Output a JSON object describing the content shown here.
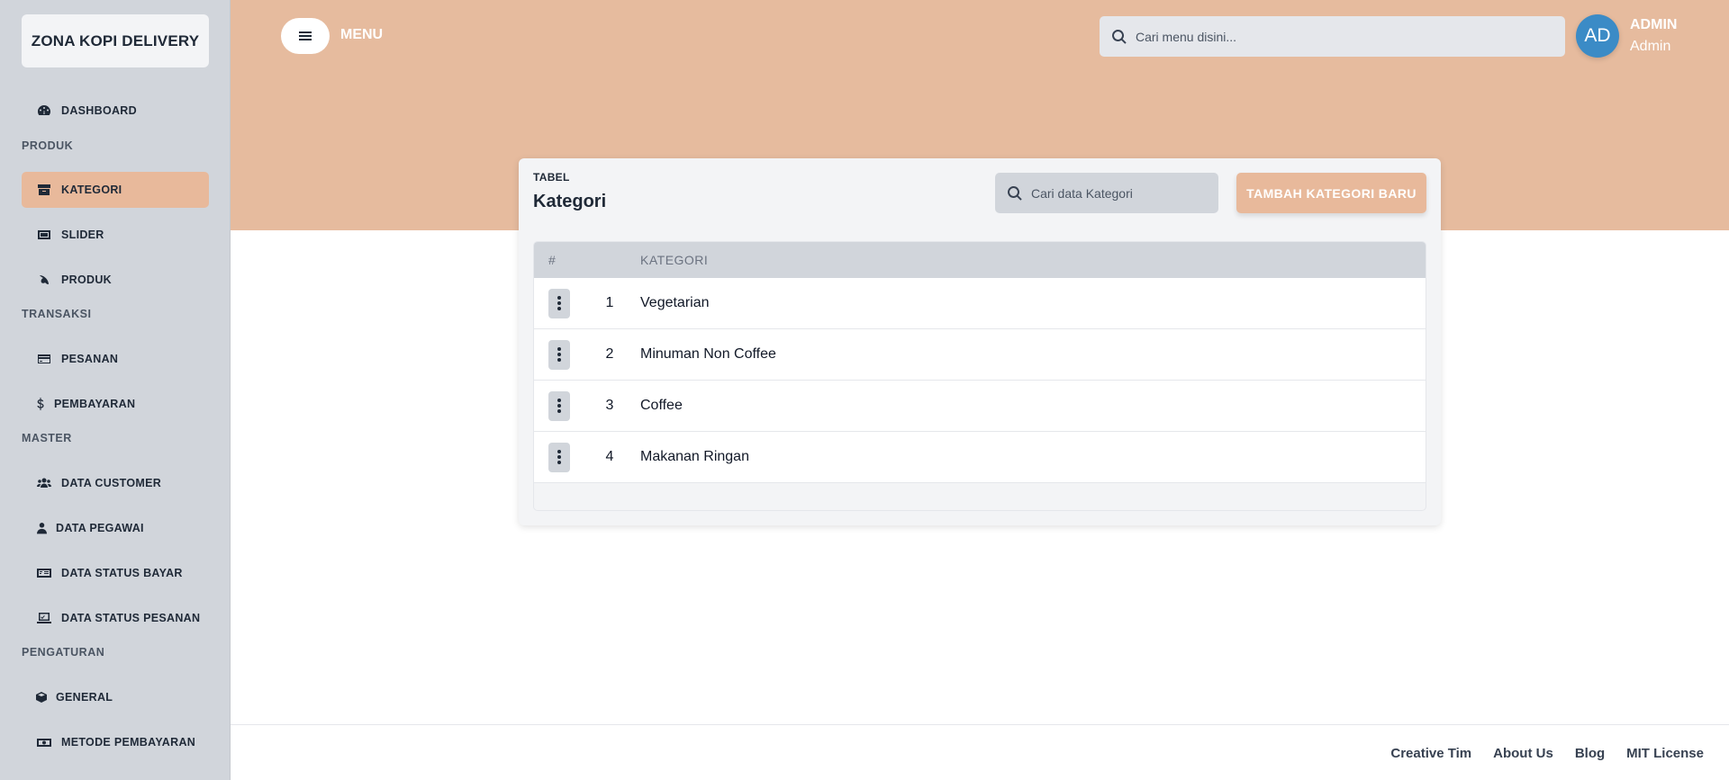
{
  "brand": "ZONA KOPI DELIVERY",
  "sidebar": {
    "dashboard": "DASHBOARD",
    "sections": {
      "produk": "PRODUK",
      "transaksi": "TRANSAKSI",
      "master": "MASTER",
      "pengaturan": "PENGATURAN"
    },
    "items": {
      "kategori": "KATEGORI",
      "slider": "SLIDER",
      "produk": "PRODUK",
      "pesanan": "PESANAN",
      "pembayaran": "PEMBAYARAN",
      "data_customer": "DATA CUSTOMER",
      "data_pegawai": "DATA PEGAWAI",
      "data_status_bayar": "DATA STATUS BAYAR",
      "data_status_pesanan": "DATA STATUS PESANAN",
      "general": "GENERAL",
      "metode_pembayaran": "METODE PEMBAYARAN"
    },
    "active": "KATEGORI"
  },
  "header": {
    "menu_label": "MENU",
    "search_placeholder": "Cari menu disini...",
    "avatar_initials": "AD",
    "user_name": "ADMIN",
    "user_role": "Admin"
  },
  "card": {
    "subtitle": "TABEL",
    "title": "Kategori",
    "search_placeholder": "Cari data Kategori",
    "add_button": "TAMBAH KATEGORI BARU",
    "columns": [
      "#",
      "KATEGORI"
    ],
    "rows": [
      {
        "no": "1",
        "name": "Vegetarian"
      },
      {
        "no": "2",
        "name": "Minuman Non Coffee"
      },
      {
        "no": "3",
        "name": "Coffee"
      },
      {
        "no": "4",
        "name": "Makanan Ringan"
      }
    ]
  },
  "footer": {
    "links": [
      "Creative Tim",
      "About Us",
      "Blog",
      "MIT License"
    ]
  },
  "colors": {
    "accent": "#e6bb9e",
    "sidebar": "#d1d5db",
    "avatar": "#3b8bc6"
  }
}
